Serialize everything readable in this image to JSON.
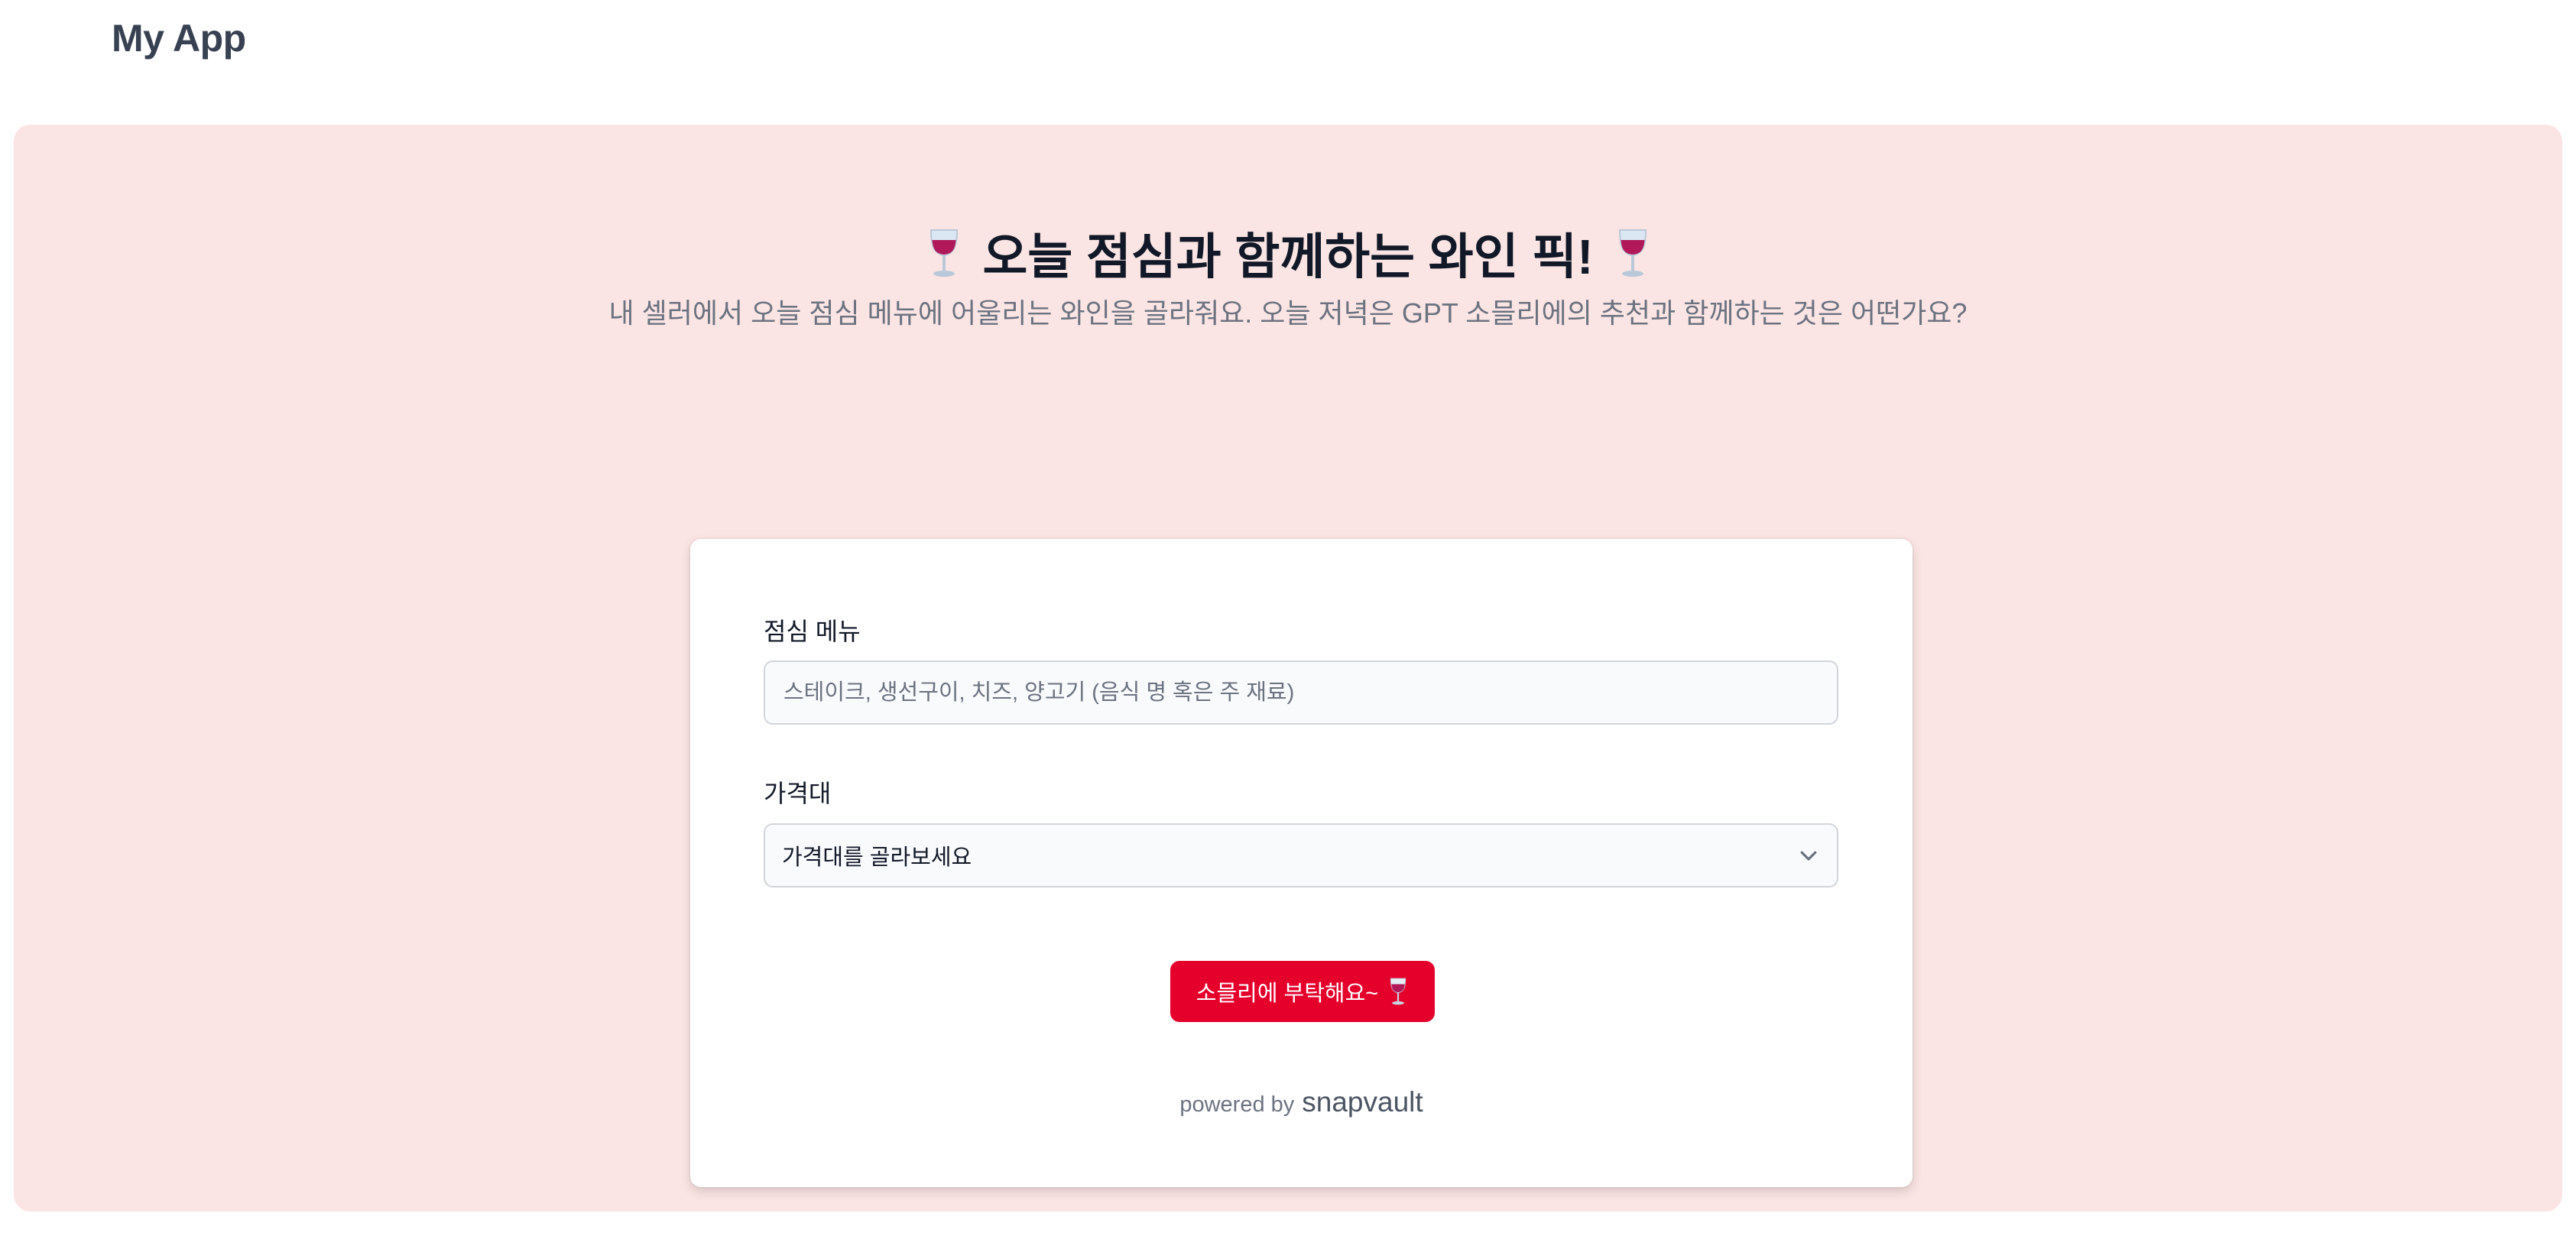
{
  "app": {
    "title": "My App"
  },
  "hero": {
    "title": "오늘 점심과 함께하는 와인 픽!",
    "subtitle": "내 셀러에서 오늘 점심 메뉴에 어울리는 와인을 골라줘요. 오늘 저녁은 GPT 소믈리에의 추천과 함께하는 것은 어떤가요?",
    "background_color": "#fbe5e4",
    "icon": "wine-glass-icon"
  },
  "form": {
    "menu_label": "점심 메뉴",
    "menu_value": "",
    "menu_placeholder": "스테이크, 생선구이, 치즈, 양고기 (음식 명 혹은 주 재료)",
    "price_label": "가격대",
    "price_selected": "가격대를 골라보세요",
    "submit_label": "소믈리에 부탁해요~",
    "submit_color": "#e4002b"
  },
  "footer": {
    "powered_prefix": "powered by",
    "brand": "snapvault"
  }
}
